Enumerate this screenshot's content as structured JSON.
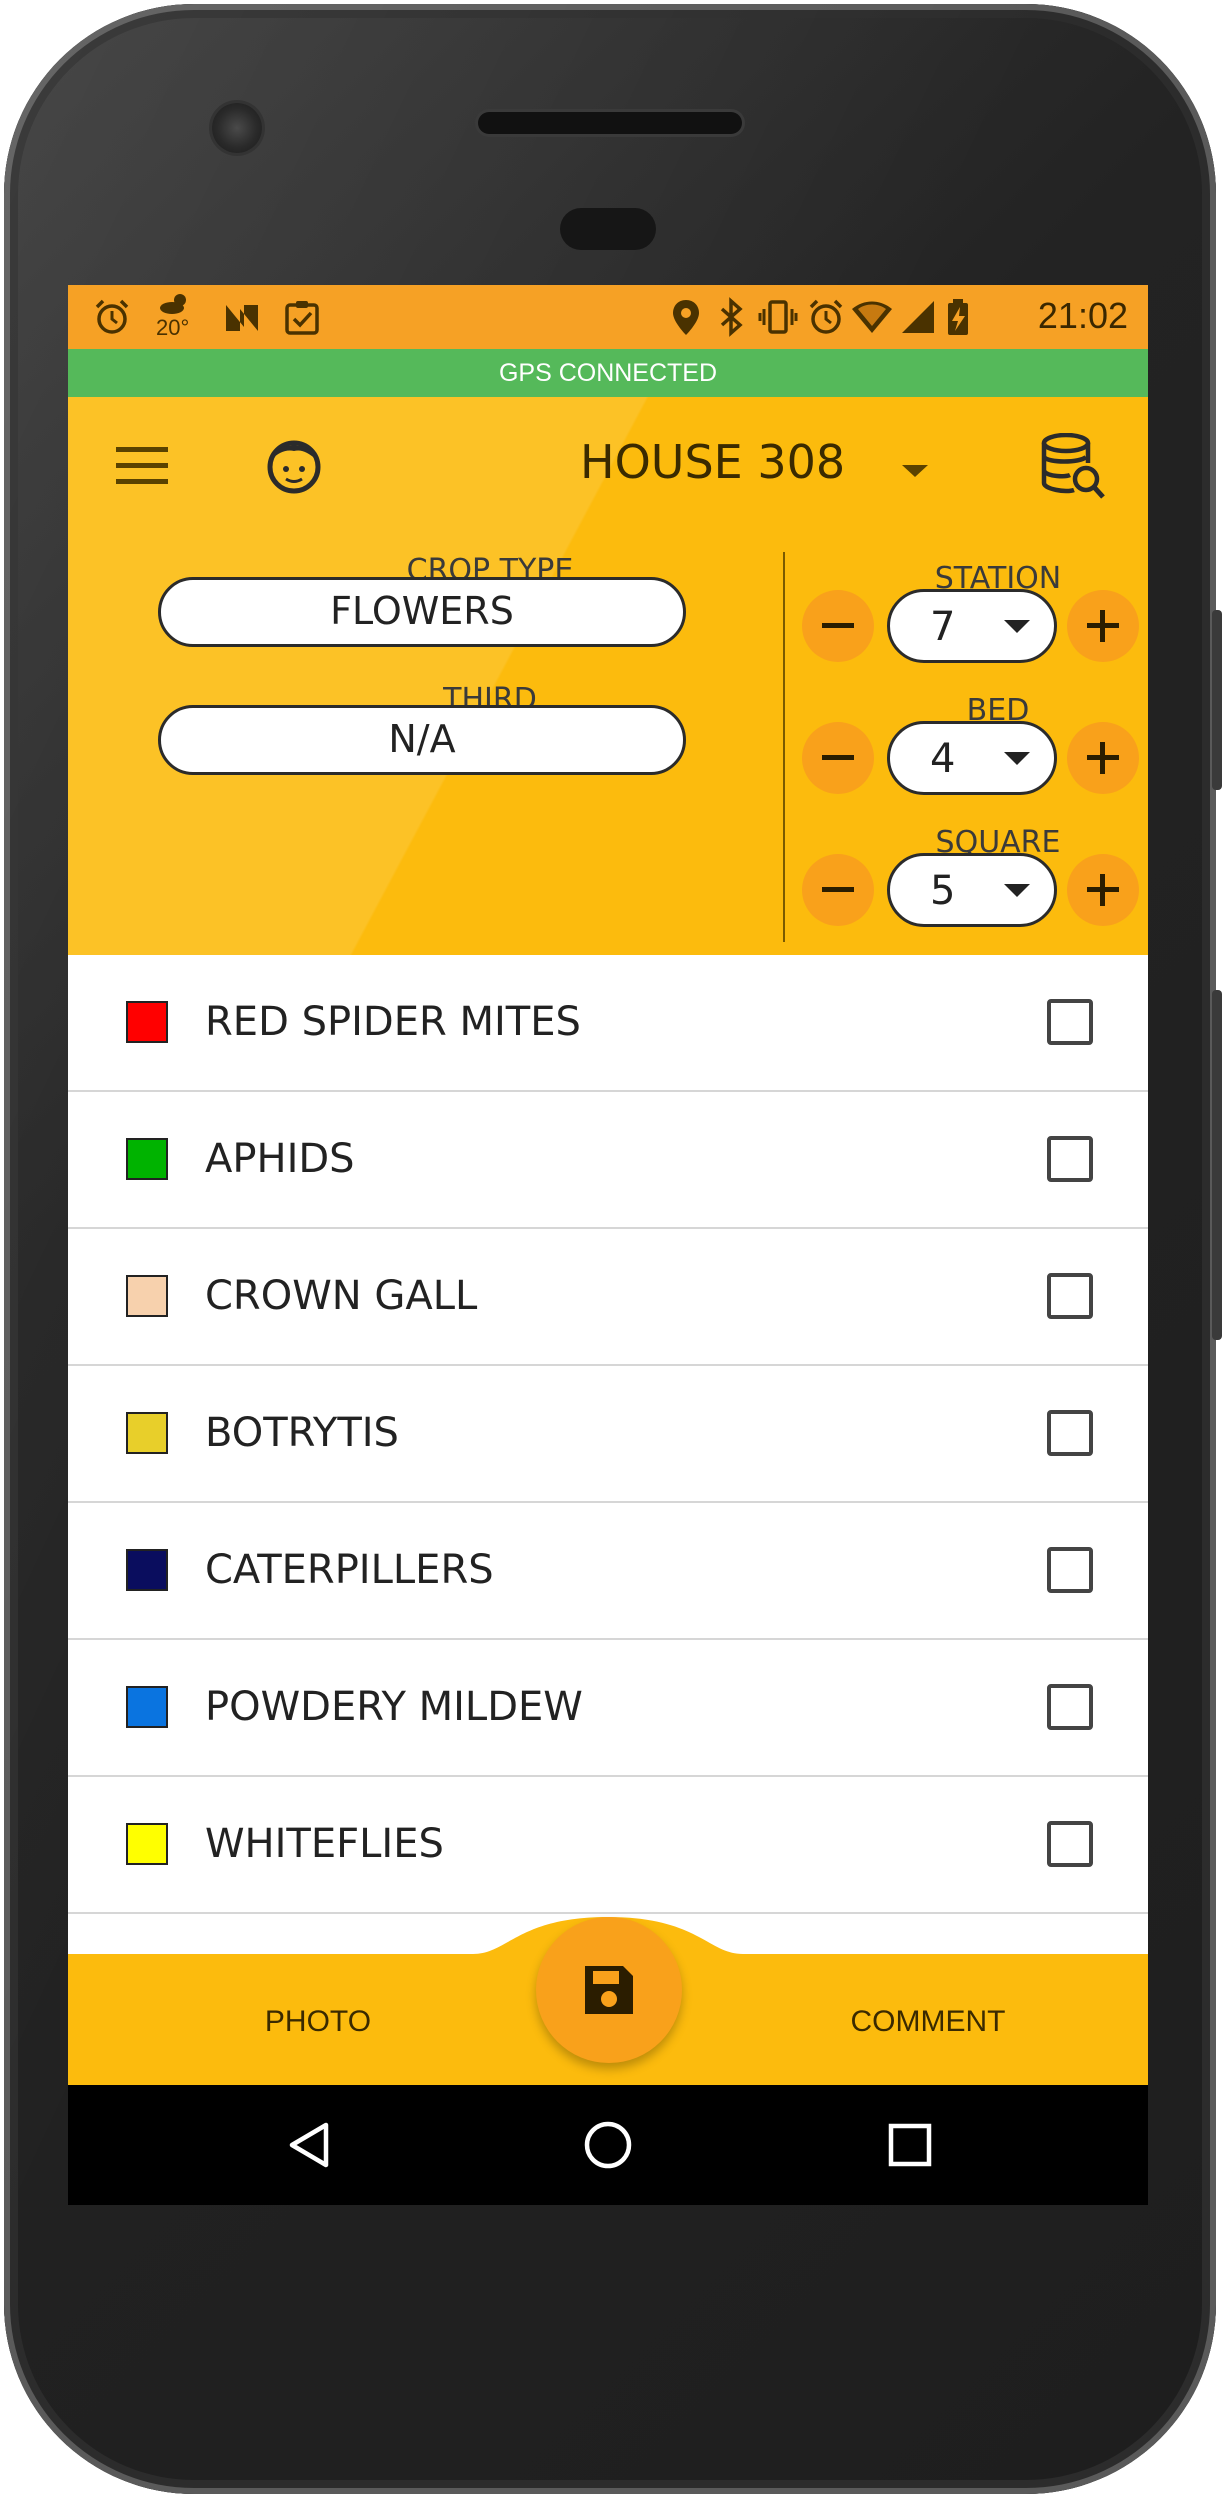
{
  "status_bar": {
    "time": "21:02",
    "weather_temp": "20°",
    "left_icons": [
      "alarm-icon",
      "weather-icon",
      "n-app-icon",
      "clipboard-check-icon"
    ],
    "right_icons": [
      "location-icon",
      "bluetooth-icon",
      "vibrate-icon",
      "alarm-icon",
      "wifi-icon",
      "signal-icon",
      "battery-charging-icon"
    ]
  },
  "gps_banner": "GPS CONNECTED",
  "header": {
    "house_title": "HOUSE 308",
    "crop_type_label": "CROP TYPE",
    "crop_type_value": "FLOWERS",
    "third_label": "THIRD",
    "third_value": "N/A",
    "station_label": "STATION",
    "station_value": "7",
    "bed_label": "BED",
    "bed_value": "4",
    "square_label": "SQUARE",
    "square_value": "5"
  },
  "pests": [
    {
      "label": "RED SPIDER MITES",
      "color": "#ff0000",
      "checked": false
    },
    {
      "label": "APHIDS",
      "color": "#00b300",
      "checked": false
    },
    {
      "label": "CROWN GALL",
      "color": "#f7d1ad",
      "checked": false
    },
    {
      "label": "BOTRYTIS",
      "color": "#e8cf2a",
      "checked": false
    },
    {
      "label": "CATERPILLERS",
      "color": "#0a0d5e",
      "checked": false
    },
    {
      "label": "POWDERY MILDEW",
      "color": "#0a74e0",
      "checked": false
    },
    {
      "label": "WHITEFLIES",
      "color": "#ffff00",
      "checked": false
    }
  ],
  "bottom_bar": {
    "photo_label": "PHOTO",
    "comment_label": "COMMENT"
  },
  "colors": {
    "accent_yellow": "#fcbb0d",
    "accent_orange": "#f9a11b",
    "status_bar": "#f6a125",
    "gps_green": "#55b95a"
  }
}
